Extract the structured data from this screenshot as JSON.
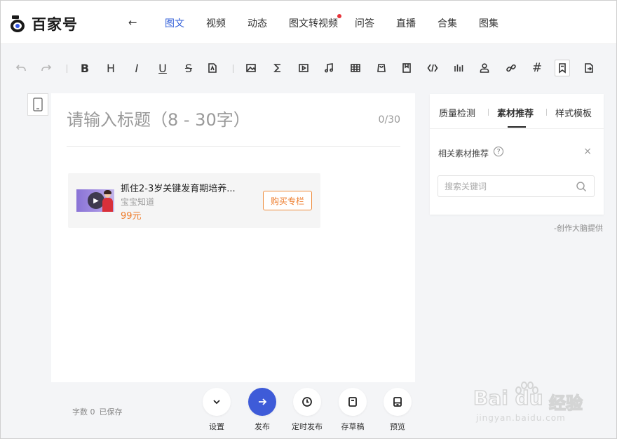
{
  "app": {
    "name": "百家号"
  },
  "nav": {
    "tabs": [
      {
        "label": "图文",
        "active": true
      },
      {
        "label": "视频"
      },
      {
        "label": "动态"
      },
      {
        "label": "图文转视频",
        "has_dot": true
      },
      {
        "label": "问答"
      },
      {
        "label": "直播"
      },
      {
        "label": "合集"
      },
      {
        "label": "图集"
      }
    ]
  },
  "toolbar": {
    "bold": "B",
    "heading": "H",
    "italic": "I",
    "underline": "U",
    "strike": "S",
    "hash": "#"
  },
  "editor": {
    "title_placeholder": "请输入标题（8 - 30字）",
    "title_count": "0/30",
    "card": {
      "title": "抓住2-3岁关键发育期培养...",
      "source": "宝宝知道",
      "price": "99元",
      "buy_label": "购买专栏"
    }
  },
  "panel": {
    "tabs": [
      {
        "label": "质量检测"
      },
      {
        "label": "素材推荐",
        "active": true
      },
      {
        "label": "样式模板"
      }
    ],
    "heading": "相关素材推荐",
    "help": "?",
    "close": "×",
    "search_placeholder": "搜索关键词",
    "provided_by": "-创作大脑提供"
  },
  "footer": {
    "word_count": "字数 0",
    "save_status": "已保存",
    "actions": [
      {
        "label": "设置"
      },
      {
        "label": "发布"
      },
      {
        "label": "定时发布"
      },
      {
        "label": "存草稿"
      },
      {
        "label": "预览"
      }
    ]
  },
  "watermark": {
    "brand": "Bai du",
    "product": "经验",
    "url": "jingyan.baidu.com"
  },
  "colors": {
    "accent": "#3562d9",
    "publish": "#3e5bd8",
    "price": "#ee7d2c",
    "notification_dot": "#e6333a"
  }
}
